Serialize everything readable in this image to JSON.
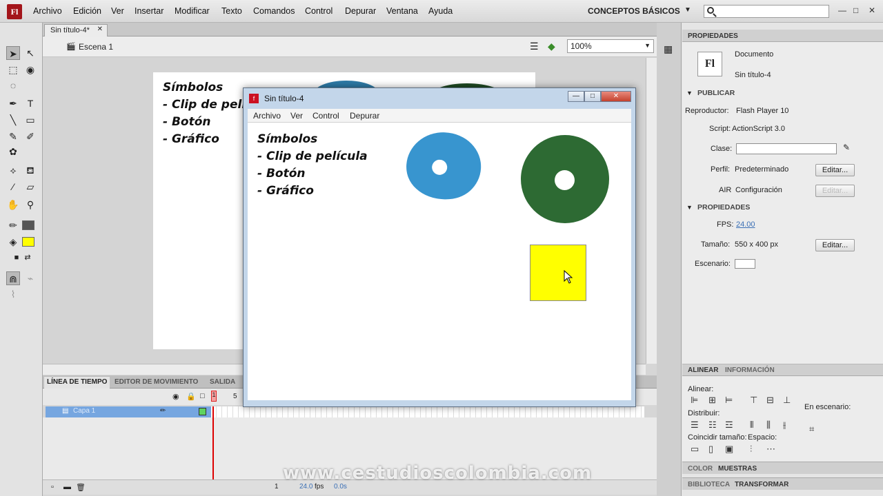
{
  "menubar": {
    "logo": "Fl",
    "items": [
      "Archivo",
      "Edición",
      "Ver",
      "Insertar",
      "Modificar",
      "Texto",
      "Comandos",
      "Control",
      "Depurar",
      "Ventana",
      "Ayuda"
    ],
    "workspace": "CONCEPTOS BÁSICOS",
    "search_placeholder": ""
  },
  "document": {
    "tab_label": "Sin título-4*",
    "scene_label": "Escena 1",
    "zoom": "100%",
    "stage_text": [
      "Símbolos",
      "- Clip de peli",
      "- Botón",
      "- Gráfico"
    ]
  },
  "toolbar": {
    "stroke_color": "#555555",
    "fill_color": "#ffff00"
  },
  "timeline": {
    "tabs": [
      "LÍNEA DE TIEMPO",
      "EDITOR DE MOVIMIENTO",
      "SALIDA"
    ],
    "layer_name": "Capa 1",
    "frame_numbers": [
      "1",
      "5"
    ],
    "footer_frame": "1",
    "footer_fps": "24.0",
    "footer_fps_unit": "fps",
    "footer_time": "0.0s"
  },
  "flash_player": {
    "title": "Sin título-4",
    "menu": [
      "Archivo",
      "Ver",
      "Control",
      "Depurar"
    ],
    "text": [
      "Símbolos",
      "- Clip de película",
      "- Botón",
      "- Gráfico"
    ],
    "colors": {
      "blue_clip": "#3895cf",
      "green_clip": "#2d6a33",
      "button": "#ffff00"
    }
  },
  "properties": {
    "tab": "PROPIEDADES",
    "icon_label": "Fl",
    "doc_type": "Documento",
    "doc_name": "Sin título-4",
    "publish_section": "PUBLICAR",
    "player_label": "Reproductor:",
    "player_value": "Flash Player 10",
    "script_label": "Script:",
    "script_value": "ActionScript 3.0",
    "class_label": "Clase:",
    "profile_label": "Perfil:",
    "profile_value": "Predeterminado",
    "edit_label": "Editar...",
    "air_label": "AIR",
    "air_value": "Configuración",
    "props_section": "PROPIEDADES",
    "fps_label": "FPS:",
    "fps_value": "24.00",
    "size_label": "Tamaño:",
    "size_value": "550 x 400 px",
    "stage_label": "Escenario:"
  },
  "align_panel": {
    "tabs": [
      "ALINEAR",
      "INFORMACIÓN"
    ],
    "align_label": "Alinear:",
    "distribute_label": "Distribuir:",
    "match_label": "Coincidir tamaño:",
    "space_label": "Espacio:",
    "on_stage_label": "En escenario:"
  },
  "bottom_panels": {
    "row1": [
      "COLOR",
      "MUESTRAS"
    ],
    "row2": [
      "BIBLIOTECA",
      "TRANSFORMAR"
    ]
  },
  "watermark": "www.cestudioscolombia.com"
}
